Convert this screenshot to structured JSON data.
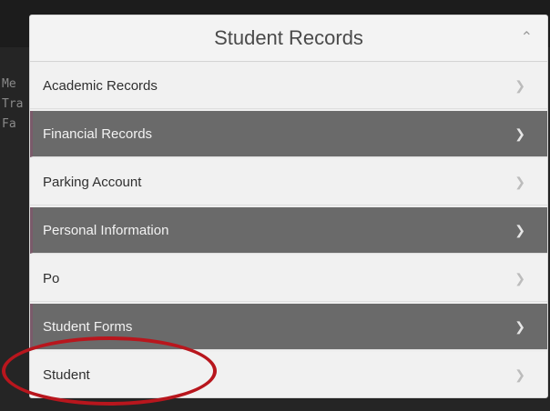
{
  "panel": {
    "title": "Student Records",
    "header_icon": "chevron-up-icon"
  },
  "menu": {
    "items": [
      {
        "label": "Academic Records",
        "style": "light",
        "icon": "chevron-right-icon"
      },
      {
        "label": "Financial Records",
        "style": "dark",
        "icon": "chevron-right-icon"
      },
      {
        "label": "Parking Account",
        "style": "light",
        "icon": "chevron-right-icon"
      },
      {
        "label": "Personal Information",
        "style": "dark",
        "icon": "chevron-right-icon"
      },
      {
        "label": "Po",
        "style": "light",
        "icon": "chevron-right-icon"
      },
      {
        "label": "Student Forms",
        "style": "dark",
        "icon": "chevron-right-icon"
      },
      {
        "label": "Student",
        "style": "light",
        "icon": "chevron-right-icon"
      }
    ]
  },
  "colors": {
    "dark_row": "#6a6a6a",
    "light_row": "#f1f1f1",
    "highlight": "#b8161d"
  },
  "backdrop": {
    "side_letters": [
      "Me",
      "Tra",
      "Fa"
    ]
  }
}
